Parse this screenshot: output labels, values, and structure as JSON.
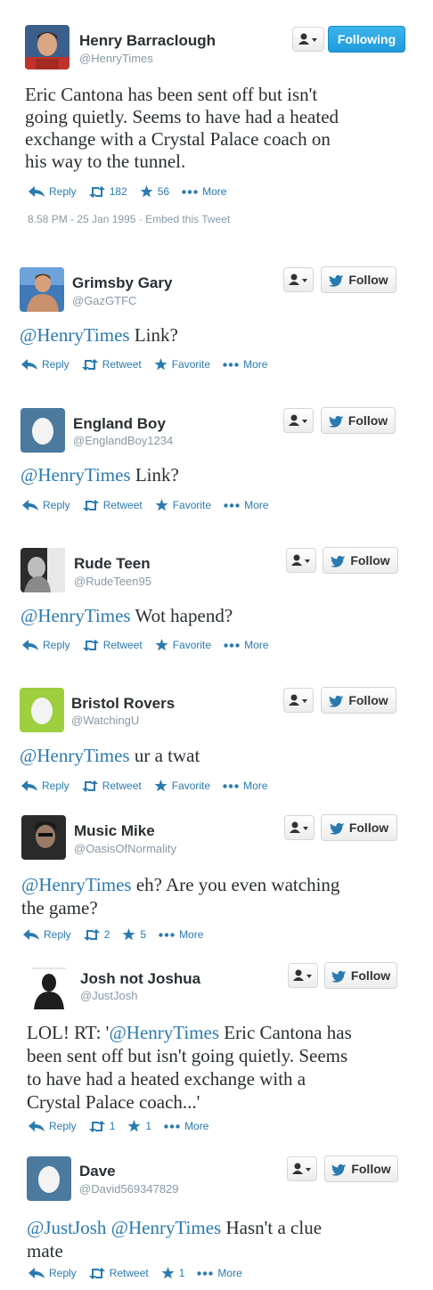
{
  "accent": "#2a7aaf",
  "main": {
    "name": "Henry Barraclough",
    "handle": "@HenryTimes",
    "follow_label": "Following",
    "lines": [
      "Eric Cantona has been sent off but isn't",
      "going quietly. Seems to have had a heated",
      "exchange with a Crystal Palace coach on",
      "his way to the tunnel."
    ],
    "actions": {
      "reply": "Reply",
      "retweet": "182",
      "favorite": "56",
      "more": "More"
    },
    "timestamp": "8.58 PM - 25 Jan 1995",
    "separator": "·",
    "embed": "Embed this Tweet"
  },
  "replies": [
    {
      "name": "Grimsby Gary",
      "handle": "@GazGTFC",
      "follow_label": "Follow",
      "lines": [
        [
          {
            "mention": "@HenryTimes"
          },
          {
            "text": " Link?"
          }
        ]
      ],
      "actions": {
        "reply": "Reply",
        "retweet": "Retweet",
        "favorite": "Favorite",
        "more": "More"
      }
    },
    {
      "name": "England Boy",
      "handle": "@EnglandBoy1234",
      "follow_label": "Follow",
      "lines": [
        [
          {
            "mention": "@HenryTimes"
          },
          {
            "text": " Link?"
          }
        ]
      ],
      "actions": {
        "reply": "Reply",
        "retweet": "Retweet",
        "favorite": "Favorite",
        "more": "More"
      }
    },
    {
      "name": "Rude Teen",
      "handle": "@RudeTeen95",
      "follow_label": "Follow",
      "lines": [
        [
          {
            "mention": "@HenryTimes"
          },
          {
            "text": " Wot hapend?"
          }
        ]
      ],
      "actions": {
        "reply": "Reply",
        "retweet": "Retweet",
        "favorite": "Favorite",
        "more": "More"
      }
    },
    {
      "name": "Bristol Rovers",
      "handle": "@WatchingU",
      "follow_label": "Follow",
      "lines": [
        [
          {
            "mention": "@HenryTimes"
          },
          {
            "text": " ur a twat"
          }
        ]
      ],
      "actions": {
        "reply": "Reply",
        "retweet": "Retweet",
        "favorite": "Favorite",
        "more": "More"
      }
    },
    {
      "name": "Music Mike",
      "handle": "@OasisOfNormality",
      "follow_label": "Follow",
      "lines": [
        [
          {
            "mention": "@HenryTimes"
          },
          {
            "text": " eh? Are you even watching"
          }
        ],
        [
          {
            "text": "the game?"
          }
        ]
      ],
      "actions": {
        "reply": "Reply",
        "retweet": "2",
        "favorite": "5",
        "more": "More"
      }
    },
    {
      "name": "Josh not Joshua",
      "handle": "@JustJosh",
      "follow_label": "Follow",
      "lines": [
        [
          {
            "text": "LOL! RT: '"
          },
          {
            "mention": "@HenryTimes"
          },
          {
            "text": " Eric Cantona has"
          }
        ],
        [
          {
            "text": "been sent off but isn't going quietly. Seems"
          }
        ],
        [
          {
            "text": "to have had a heated exchange with a"
          }
        ],
        [
          {
            "text": "Crystal Palace coach...'"
          }
        ]
      ],
      "actions": {
        "reply": "Reply",
        "retweet": "1",
        "favorite": "1",
        "more": "More"
      }
    },
    {
      "name": "Dave",
      "handle": "@David569347829",
      "follow_label": "Follow",
      "lines": [
        [
          {
            "mention": "@JustJosh"
          },
          {
            "text": " "
          },
          {
            "mention": "@HenryTimes"
          },
          {
            "text": " Hasn't a clue"
          }
        ],
        [
          {
            "text": "mate"
          }
        ]
      ],
      "actions": {
        "reply": "Reply",
        "retweet": "Retweet",
        "favorite": "1",
        "more": "More"
      }
    }
  ]
}
